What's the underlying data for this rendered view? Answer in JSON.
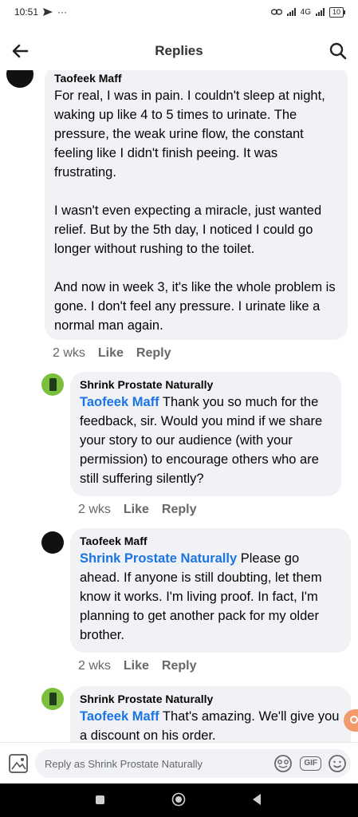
{
  "status_bar": {
    "time": "10:51",
    "network_label": "4G",
    "battery": "10"
  },
  "header": {
    "title": "Replies",
    "back_icon": "arrow-left-icon",
    "search_icon": "search-icon"
  },
  "comments": [
    {
      "author": "Taofeek Maff",
      "mention": "",
      "text": "For real, I was in pain. I couldn't sleep at night, waking up like 4 to 5 times to urinate. The pressure, the weak urine flow, the constant feeling like I didn't finish peeing. It was frustrating.\n\nI wasn't even expecting a miracle, just wanted relief. But by the 5th day, I noticed I could go longer without rushing to the toilet.\n\nAnd now in week 3, it's like the whole problem is gone. I don't feel any pressure. I urinate like a normal man again.",
      "time": "2 wks",
      "like": "Like",
      "reply": "Reply"
    },
    {
      "author": "Shrink Prostate Naturally",
      "mention": "Taofeek Maff",
      "text": " Thank you so much for the feedback, sir. Would you mind if we share your story to our audience (with your permission) to encourage others who are still suffering silently?",
      "time": "2 wks",
      "like": "Like",
      "reply": "Reply"
    },
    {
      "author": "Taofeek Maff",
      "mention": "Shrink Prostate Naturally",
      "text": " Please go ahead. If anyone is still doubting, let them know it works. I'm living proof. In fact, I'm planning to get another pack for my older brother.",
      "time": "2 wks",
      "like": "Like",
      "reply": "Reply"
    },
    {
      "author": "Shrink Prostate Naturally",
      "mention": "Taofeek Maff",
      "text": " That's amazing. We'll give you a discount on his order."
    }
  ],
  "composer": {
    "placeholder": "Reply as Shrink Prostate Naturally",
    "gif_label": "GIF"
  },
  "colors": {
    "bubble": "#f0f2f5",
    "mention": "#1b74e4",
    "meta": "#65676b"
  }
}
